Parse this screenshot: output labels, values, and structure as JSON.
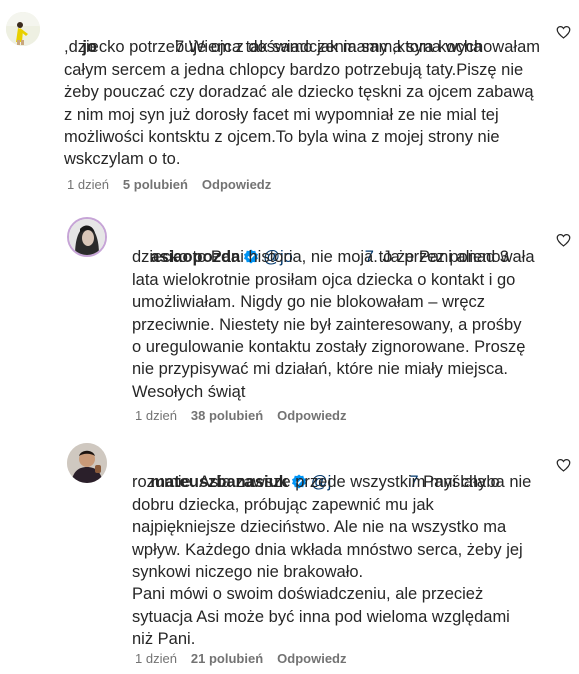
{
  "comments": [
    {
      "username": "jo",
      "mention_suffix": "",
      "text_first_line": "7 Wiem z doświadczenia sama syna wychowałam",
      "text_rest": ",dziecko potrzebuje ojca tak samo jak mamy ,ktora kocha\ncałym sercem a jedna chlopcy bardzo potrzebują taty.Piszę nie\nżeby pouczać czy doradzać ale dziecko tęskni za ojcem zabawą\nz nim moj syn już dorosły facet mi wypomniał ze nie mial tej\nmożliwości kontsktu z ojcem.To byla wina z mojej strony nie\nwskczylam o to.",
      "time": "1 dzień",
      "likes": "5 polubień",
      "reply": "Odpowiedz"
    },
    {
      "username": "asiaopozda",
      "mention": "@jo",
      "mention_tail": "7",
      "text_first_line": " to że Pani alienowała",
      "text_rest": "dziecko to Pani historia, nie moja. Ja przez ponad 3\nlata wielokrotnie prosiłam ojca dziecka o kontakt i go\numożliwiałam. Nigdy go nie blokowałam – wręcz\nprzeciwnie. Niestety nie był zainteresowany, a prośby\no uregulowanie kontaktu zostały zignorowane. Proszę\nnie przypisywać mi działań, które nie miały miejsca.\nWesołych świąt",
      "time": "1 dzień",
      "likes": "38 polubień",
      "reply": "Odpowiedz"
    },
    {
      "username": "mateuszbanasiuk",
      "mention": "@j",
      "mention_tail": "7",
      "text_first_line": " Pani chyba nie",
      "text_rest": "rozumie. Asia zawsze przede wszystkim myślała o\ndobru dziecka, próbując zapewnić mu jak\nnajpiękniejsze dzieciństwo. Ale nie na wszystko ma\nwpływ. Każdego dnia wkłada mnóstwo serca, żeby jej\nsynkowi niczego nie brakowało.\nPani mówi o swoim doświadczeniu, ale przecież\nsytuacja Asi może być inna pod wieloma względami\nniż Pani.",
      "time": "1 dzień",
      "likes": "21 polubień",
      "reply": "Odpowiedz"
    }
  ],
  "colors": {
    "text": "#262626",
    "secondary": "#737373",
    "mention": "#00376b",
    "verified": "#0095f6"
  },
  "icons": [
    "heart-icon",
    "verified-badge-icon"
  ]
}
